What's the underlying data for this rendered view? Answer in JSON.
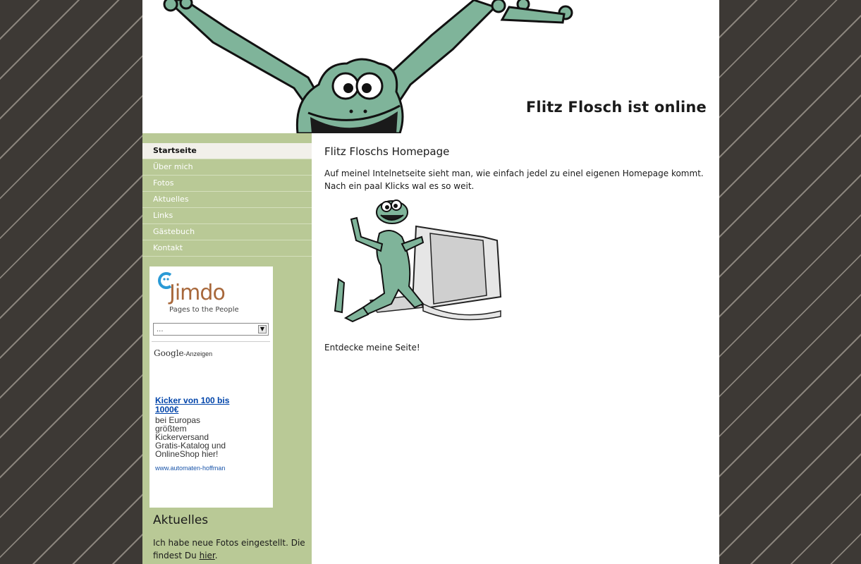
{
  "header": {
    "site_title": "Flitz Flosch ist online"
  },
  "nav": {
    "items": [
      {
        "label": "Startseite",
        "active": true
      },
      {
        "label": "Über mich",
        "active": false
      },
      {
        "label": "Fotos",
        "active": false
      },
      {
        "label": "Aktuelles",
        "active": false
      },
      {
        "label": "Links",
        "active": false
      },
      {
        "label": "Gästebuch",
        "active": false
      },
      {
        "label": "Kontakt",
        "active": false
      }
    ]
  },
  "sidebar": {
    "jimdo": {
      "logo_text": "Jimdo",
      "tagline": "Pages to the People"
    },
    "select": {
      "value": "..."
    },
    "ads": {
      "google_brand": "Google",
      "google_suffix": "-Anzeigen",
      "link_text": "Kicker von 100 bis 1000€",
      "body_lines": [
        "bei Europas",
        "größtem",
        "Kickerversand",
        "Gratis-Katalog und",
        "OnlineShop hier!"
      ],
      "url": "www.automaten-hoffman"
    },
    "news": {
      "heading": "Aktuelles",
      "text": "Ich habe neue Fotos eingestellt. Die findest Du ",
      "link": "hier",
      "text_end": "."
    }
  },
  "main": {
    "title": "Flitz Floschs Homepage",
    "intro": "Auf meinel Intelnetseite sieht man, wie einfach jedel zu einel eigenen Homepage kommt. Nach ein paal Klicks wal es so weit.",
    "cta": "Entdecke meine Seite!"
  },
  "colors": {
    "background": "#3f3b37",
    "sidebar": "#b9c996",
    "frog": "#7fb49a",
    "link": "#0044aa"
  },
  "icons": [
    "frog-header-illustration",
    "jimdo-logo-icon",
    "dropdown-arrow-icon",
    "frog-computer-illustration"
  ]
}
